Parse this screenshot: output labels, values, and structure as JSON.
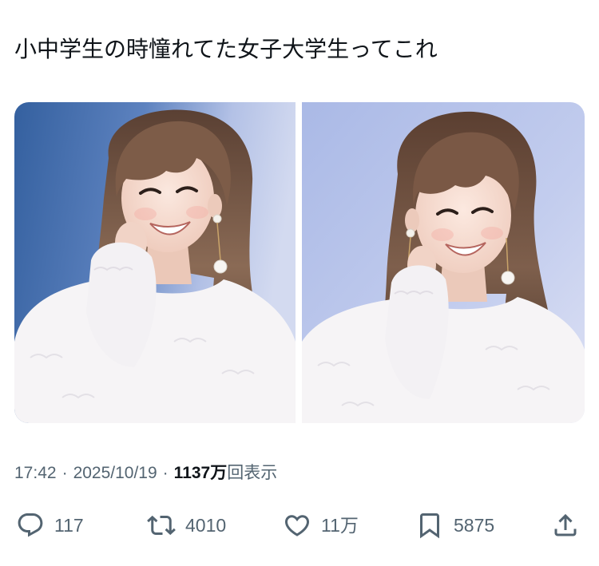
{
  "tweet": {
    "text": "小中学生の時憧れてた女子大学生ってこれ"
  },
  "meta": {
    "time": "17:42",
    "sep1": "·",
    "date": "2025/10/19",
    "sep2": "·",
    "views_count": "1137万",
    "views_label": "回表示"
  },
  "actions": {
    "reply": {
      "icon": "reply-icon",
      "count": "117"
    },
    "retweet": {
      "icon": "retweet-icon",
      "count": "4010"
    },
    "like": {
      "icon": "like-icon",
      "count": "11万"
    },
    "bookmark": {
      "icon": "bookmark-icon",
      "count": "5875"
    },
    "share": {
      "icon": "share-icon"
    }
  },
  "colors": {
    "text_primary": "#0f1419",
    "text_secondary": "#536471",
    "background": "#ffffff"
  }
}
